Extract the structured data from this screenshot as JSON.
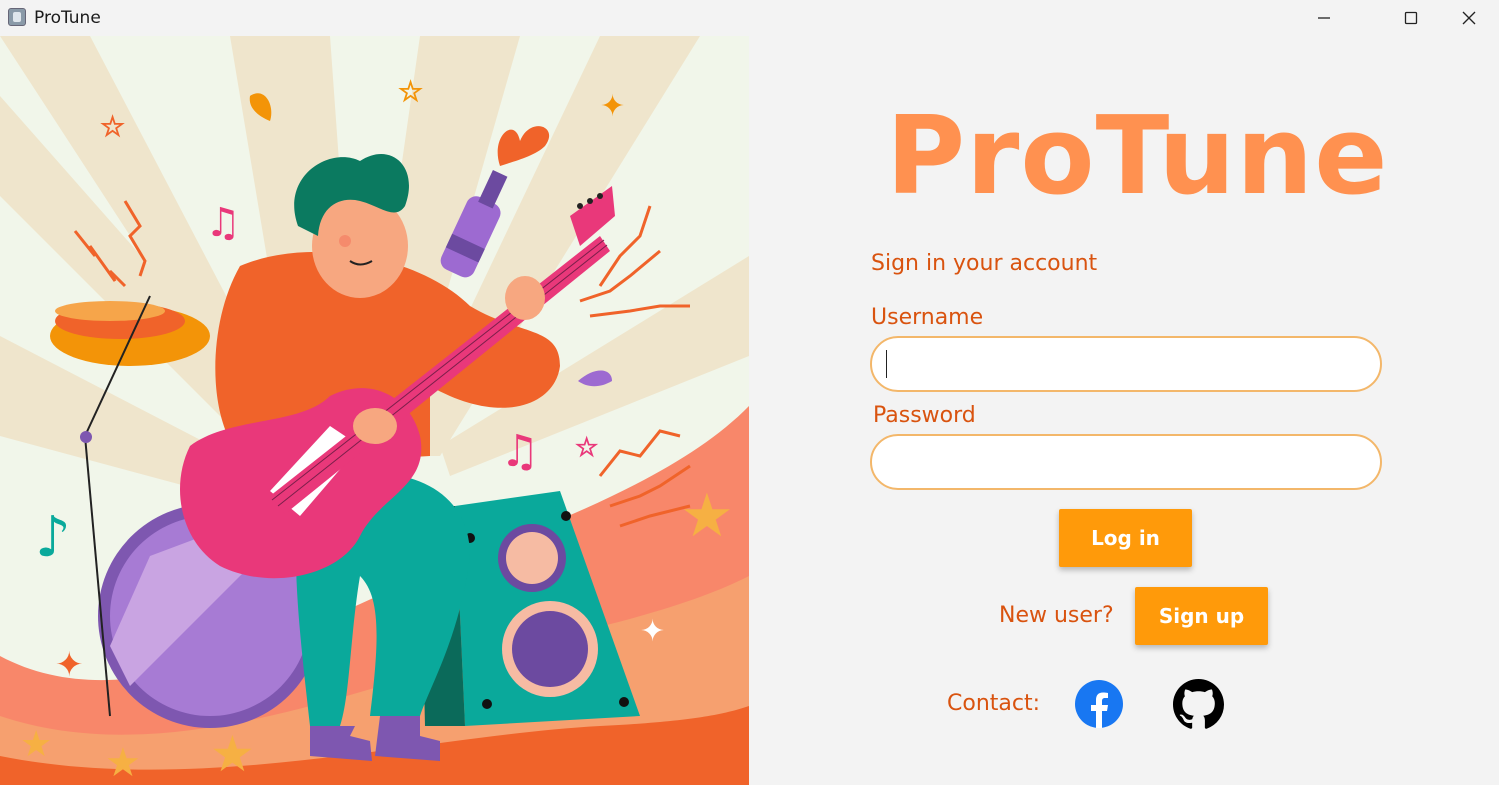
{
  "window": {
    "title": "ProTune",
    "icon": "app-icon",
    "controls": [
      "minimize-icon",
      "maximize-icon",
      "close-icon"
    ]
  },
  "illustration": {
    "subject": "guitarist-illustration"
  },
  "login": {
    "brand": "ProTune",
    "subtitle": "Sign in your account",
    "username_label": "Username",
    "username_value": "",
    "password_label": "Password",
    "password_value": "",
    "login_button": "Log in",
    "new_user_text": "New user?",
    "signup_button": "Sign up",
    "contact_label": "Contact:",
    "contact_icons": [
      "facebook-icon",
      "github-icon"
    ]
  },
  "colors": {
    "brand": "#ff9150",
    "text_accent": "#d9530f",
    "button": "#ff9a0a",
    "field_border": "#f3b76a",
    "facebook": "#1877f2",
    "github": "#000000"
  }
}
